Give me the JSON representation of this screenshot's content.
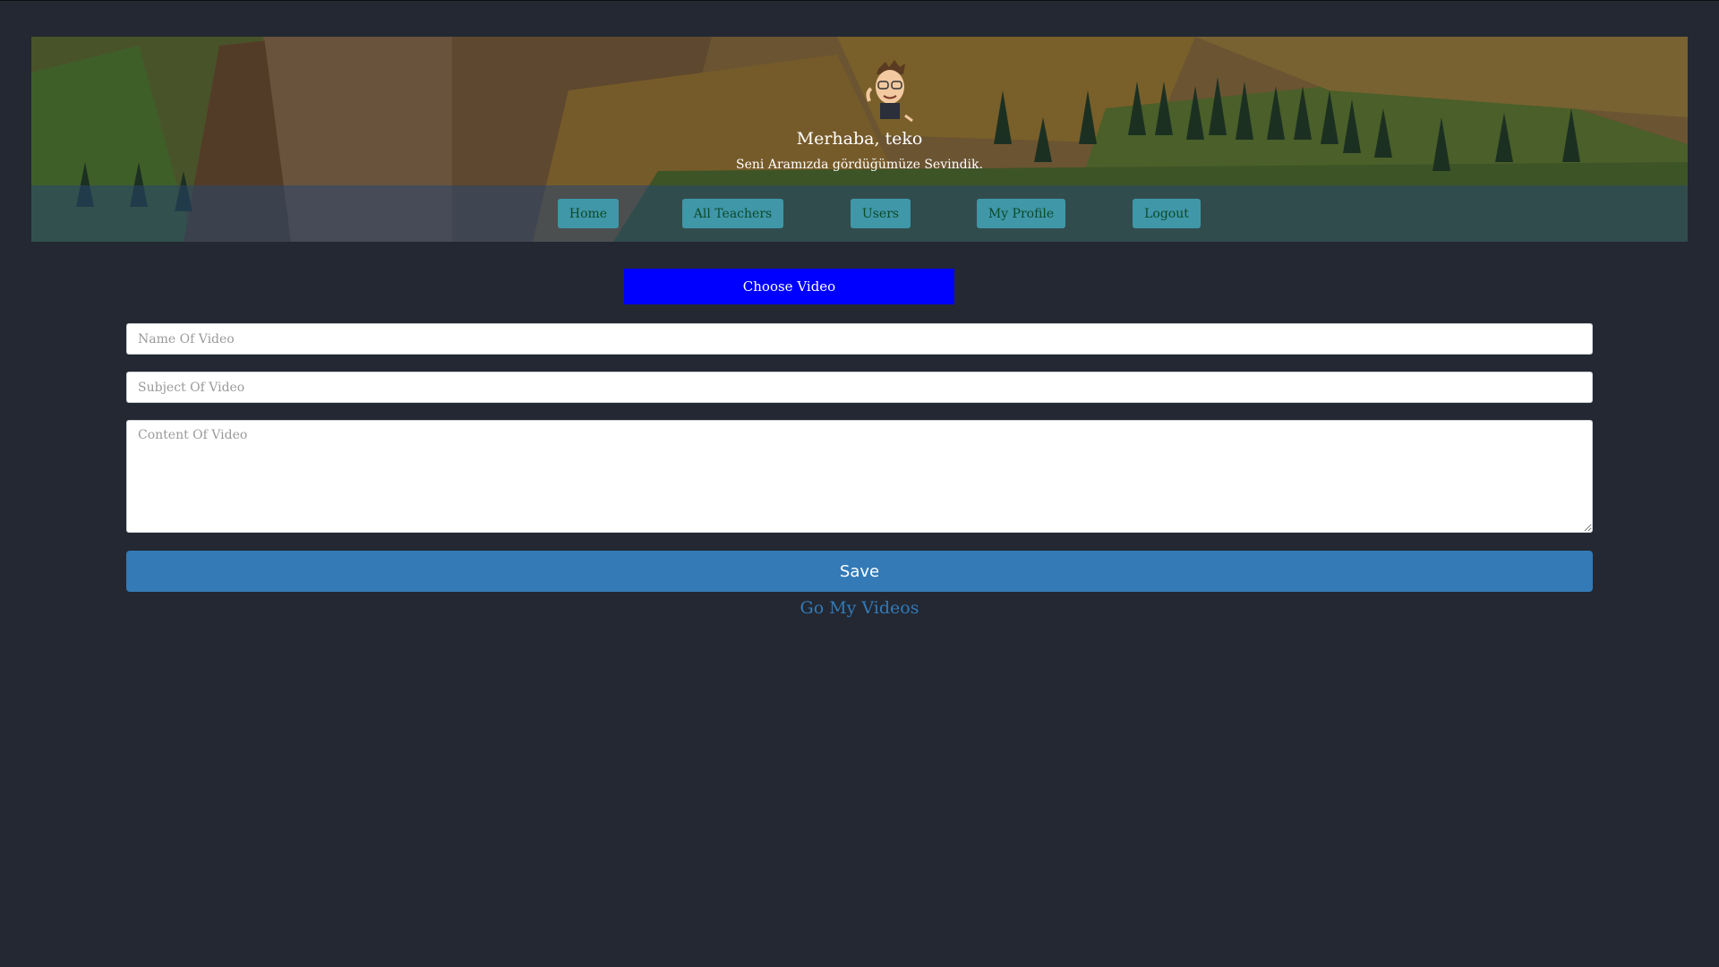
{
  "header": {
    "greeting": "Merhaba, teko",
    "subtitle": "Seni Aramızda gördüğümüze Sevindik."
  },
  "nav": {
    "items": [
      {
        "label": "Home"
      },
      {
        "label": "All Teachers"
      },
      {
        "label": "Users"
      },
      {
        "label": "My Profile"
      },
      {
        "label": "Logout"
      }
    ]
  },
  "form": {
    "choose_video_label": "Choose Video",
    "name_placeholder": "Name Of Video",
    "subject_placeholder": "Subject Of Video",
    "content_placeholder": "Content Of Video",
    "save_label": "Save",
    "go_my_videos_label": "Go My Videos"
  },
  "colors": {
    "background": "#232832",
    "choose_video": "#0000ff",
    "save_button": "#337ab7",
    "nav_button": "#3f97a8"
  }
}
